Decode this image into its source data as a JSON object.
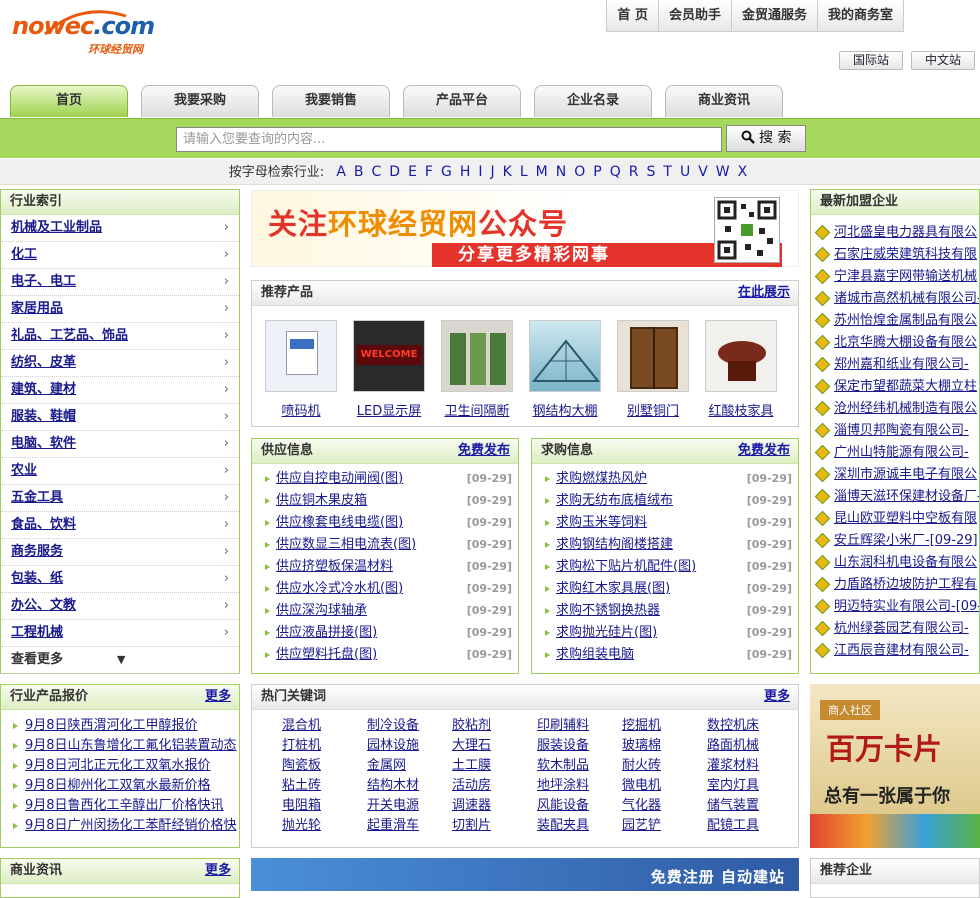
{
  "logo": {
    "name_a": "nowec",
    "name_b": ".com",
    "tagline": "环球经贸网"
  },
  "top_nav": [
    "首 页",
    "会员助手",
    "金贸通服务",
    "我的商务室"
  ],
  "lang_links": [
    "国际站",
    "中文站"
  ],
  "tabs": [
    "首页",
    "我要采购",
    "我要销售",
    "产品平台",
    "企业名录",
    "商业资讯"
  ],
  "search": {
    "placeholder": "请输入您要查询的内容...",
    "button": "搜 索"
  },
  "alpha": {
    "label": "按字母检索行业:",
    "letters": [
      "A",
      "B",
      "C",
      "D",
      "E",
      "F",
      "G",
      "H",
      "I",
      "J",
      "K",
      "L",
      "M",
      "N",
      "O",
      "P",
      "Q",
      "R",
      "S",
      "T",
      "U",
      "V",
      "W",
      "X"
    ]
  },
  "industry": {
    "title": "行业索引",
    "items": [
      "机械及工业制品",
      "化工",
      "电子、电工",
      "家居用品",
      "礼品、工艺品、饰品",
      "纺织、皮革",
      "建筑、建材",
      "服装、鞋帽",
      "电脑、软件",
      "农业",
      "五金工具",
      "食品、饮料",
      "商务服务",
      "包装、纸",
      "办公、文教",
      "工程机械"
    ],
    "more": "查看更多"
  },
  "banner": {
    "line_a": "关注",
    "line_b": "环球经贸网",
    "line_c": "公众号",
    "sub": "分享更多精彩网事"
  },
  "recommend": {
    "title": "推荐产品",
    "more": "在此展示",
    "items": [
      "喷码机",
      "LED显示屏",
      "卫生间隔断",
      "钢结构大棚",
      "别墅铜门",
      "红酸枝家具"
    ],
    "led_text": "WELCOME"
  },
  "supply": {
    "title": "供应信息",
    "more": "免费发布",
    "items": [
      {
        "t": "供应自控电动闸阀(图)",
        "d": "[09-29]"
      },
      {
        "t": "供应铜木果皮箱",
        "d": "[09-29]"
      },
      {
        "t": "供应橡套电线电缆(图)",
        "d": "[09-29]"
      },
      {
        "t": "供应数显三相电流表(图)",
        "d": "[09-29]"
      },
      {
        "t": "供应挤塑板保温材料",
        "d": "[09-29]"
      },
      {
        "t": "供应水冷式冷水机(图)",
        "d": "[09-29]"
      },
      {
        "t": "供应深沟球轴承",
        "d": "[09-29]"
      },
      {
        "t": "供应液晶拼接(图)",
        "d": "[09-29]"
      },
      {
        "t": "供应塑料托盘(图)",
        "d": "[09-29]"
      }
    ]
  },
  "purchase": {
    "title": "求购信息",
    "more": "免费发布",
    "items": [
      {
        "t": "求购燃煤热风炉",
        "d": "[09-29]"
      },
      {
        "t": "求购无纺布底植绒布",
        "d": "[09-29]"
      },
      {
        "t": "求购玉米等饲料",
        "d": "[09-29]"
      },
      {
        "t": "求购钢结构阁楼搭建",
        "d": "[09-29]"
      },
      {
        "t": "求购松下贴片机配件(图)",
        "d": "[09-29]"
      },
      {
        "t": "求购红木家具展(图)",
        "d": "[09-29]"
      },
      {
        "t": "求购不锈钢换热器",
        "d": "[09-29]"
      },
      {
        "t": "求购抛光硅片(图)",
        "d": "[09-29]"
      },
      {
        "t": "求购组装电脑",
        "d": "[09-29]"
      }
    ]
  },
  "newcomp": {
    "title": "最新加盟企业",
    "items": [
      "河北盛皇电力器具有限公",
      "石家庄威荣建筑科技有限",
      "宁津县嘉宇网带输送机械",
      "诸城市高然机械有限公司-",
      "苏州怡煌金属制品有限公",
      "北京华腾大棚设备有限公",
      "郑州嘉和纸业有限公司-",
      "保定市望都蔬菜大棚立柱",
      "沧州经纬机械制造有限公",
      "淄博贝邦陶瓷有限公司-",
      "广州山特能源有限公司-",
      "深圳市源诚丰电子有限公",
      "淄博天滋环保建材设备厂-",
      "昆山欧亚塑料中空板有限",
      "安丘辉梁小米厂-[09-29]",
      "山东润科机电设备有限公",
      "力盾路桥边坡防护工程有",
      "明迈特实业有限公司-[09-",
      "杭州绿荟园艺有限公司-",
      "江西辰音建材有限公司-"
    ]
  },
  "price": {
    "title": "行业产品报价",
    "more": "更多",
    "items": [
      "9月8日陕西渭河化工甲醇报价",
      "9月8日山东鲁增化工氟化铝装置动态",
      "9月8日河北正元化工双氧水报价",
      "9月8日柳州化工双氧水最新价格",
      "9月8日鲁西化工辛醇出厂价格快讯",
      "9月8日广州闵扬化工苯酐经销价格快"
    ]
  },
  "hotkw": {
    "title": "热门关键词",
    "more": "更多",
    "items": [
      "混合机",
      "制冷设备",
      "胶粘剂",
      "印刷辅料",
      "挖掘机",
      "数控机床",
      "打桩机",
      "园林设施",
      "大理石",
      "服装设备",
      "玻璃棉",
      "路面机械",
      "陶瓷板",
      "金属网",
      "土工膜",
      "软木制品",
      "耐火砖",
      "灌浆材料",
      "粘土砖",
      "结构木材",
      "活动房",
      "地坪涂料",
      "微电机",
      "室内灯具",
      "电阻箱",
      "开关电源",
      "调速器",
      "风能设备",
      "气化器",
      "储气装置",
      "抛光轮",
      "起重滑车",
      "切割片",
      "装配夹具",
      "园艺铲",
      "配镜工具"
    ]
  },
  "ad_card": {
    "tag": "商人社区",
    "big": "百万卡片",
    "sub": "总有一张属于你"
  },
  "bizinfo": {
    "title": "商业资讯",
    "more": "更多"
  },
  "ad_reg": {
    "text": "免费注册 自动建站"
  },
  "recent": {
    "title": "推荐企业"
  },
  "colors": {
    "accent_green": "#a6d85e",
    "border_green": "#9fcf5e",
    "link": "#1a1a8c",
    "red": "#e4332b"
  }
}
